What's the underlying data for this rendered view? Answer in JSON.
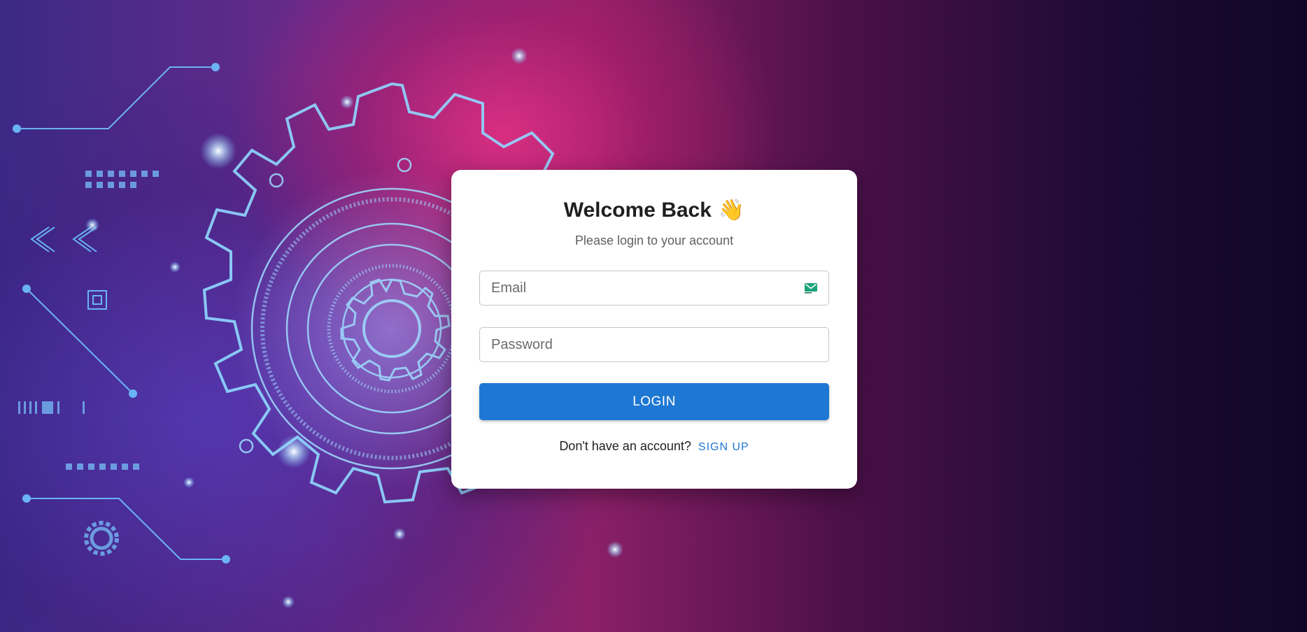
{
  "login_card": {
    "title": "Welcome Back",
    "title_emoji": "👋",
    "subtitle": "Please login to your account",
    "email": {
      "placeholder": "Email",
      "value": "",
      "icon": "mail-icon"
    },
    "password": {
      "placeholder": "Password",
      "value": ""
    },
    "login_label": "LOGIN",
    "signup_prompt": "Don't have an account?",
    "signup_label": "SIGN UP"
  },
  "colors": {
    "primary": "#1e78d3",
    "card_background": "#ffffff",
    "background_magenta": "#e83084",
    "background_dark": "#120626"
  }
}
